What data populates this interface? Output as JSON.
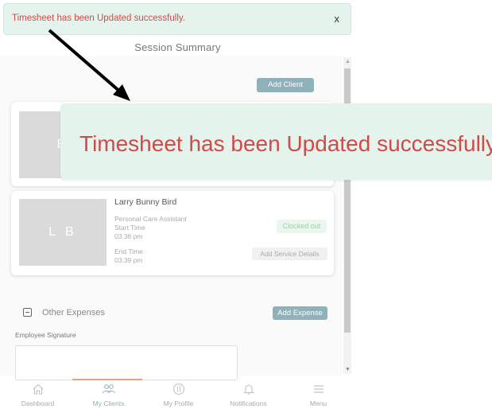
{
  "toast": {
    "message": "Timesheet has been Updated successfully.",
    "close": "x"
  },
  "zoomed_toast": {
    "message": "Timesheet has been Updated successfully."
  },
  "page": {
    "title": "Session Summary"
  },
  "actions": {
    "add_client": "Add Client",
    "add_expense": "Add Expense"
  },
  "cards": [
    {
      "initials": "B"
    },
    {
      "initials": "L B",
      "name": "Larry Bunny Bird",
      "role": "Personal Care Assistant",
      "start_label": "Start Time",
      "start_time": "03:36 pm",
      "end_label": "End Time",
      "end_time": "03:39 pm",
      "status": "Clocked out",
      "service_button": "Add Service Details"
    }
  ],
  "expenses": {
    "label": "Other Expenses"
  },
  "signature": {
    "label": "Employee Signature"
  },
  "bottom_nav": [
    {
      "label": "Dashboard",
      "icon": "home-icon"
    },
    {
      "label": "My Clients",
      "icon": "clients-icon",
      "active": true
    },
    {
      "label": "My Profile",
      "icon": "profile-icon"
    },
    {
      "label": "Notifications",
      "icon": "bell-icon"
    },
    {
      "label": "Menu",
      "icon": "menu-icon"
    }
  ],
  "colors": {
    "accent": "#8fb1b9",
    "toast_bg": "#e4f4ec",
    "toast_text": "#d04a4a",
    "status_text": "#9fd0ad"
  }
}
